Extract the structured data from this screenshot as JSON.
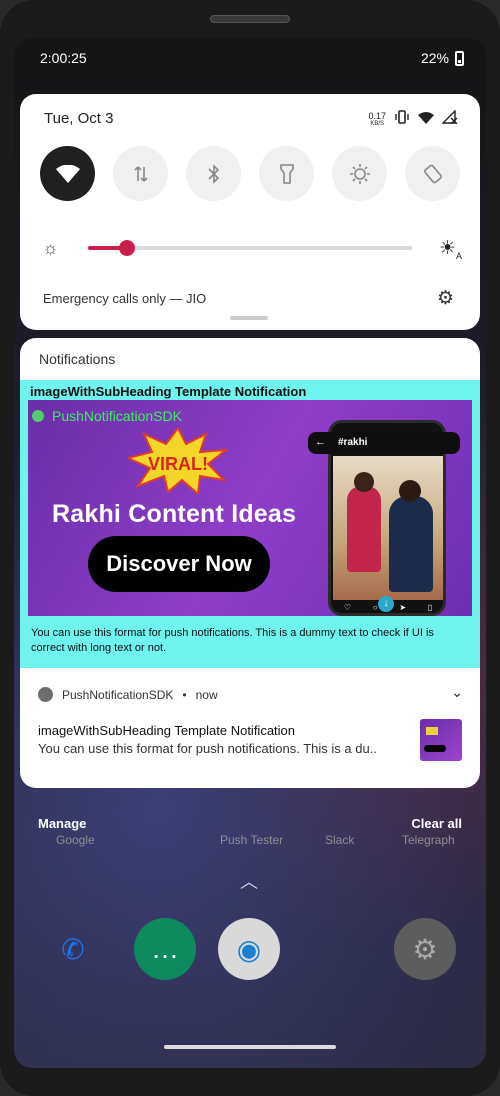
{
  "status_bar": {
    "time": "2:00:25",
    "battery": "22%"
  },
  "quick_settings": {
    "date": "Tue, Oct 3",
    "net_speed_value": "0.17",
    "net_speed_unit": "KB/S",
    "tiles": [
      {
        "name": "wifi",
        "active": true
      },
      {
        "name": "mobile-data",
        "active": false
      },
      {
        "name": "bluetooth",
        "active": false
      },
      {
        "name": "flashlight",
        "active": false
      },
      {
        "name": "auto-brightness",
        "active": false
      },
      {
        "name": "auto-rotate",
        "active": false
      }
    ],
    "brightness_level": 0.12,
    "auto_brightness_letter": "A",
    "footer_text": "Emergency calls only — JIO"
  },
  "notifications": {
    "header": "Notifications",
    "expanded": {
      "title": "imageWithSubHeading Template Notification",
      "app_name": "PushNotificationSDK",
      "banner": {
        "viral_label": "VIRAL!",
        "heading": "Rakhi Content Ideas",
        "button": "Discover Now",
        "phone_tag": "#rakhi"
      },
      "body": "You can use this format for push notifications. This is a dummy text to check if UI is correct with long text or not."
    },
    "collapsed": {
      "app_name": "PushNotificationSDK",
      "time": "now",
      "title": "imageWithSubHeading Template Notification",
      "text": "You can use this format for push notifications. This is a du.."
    }
  },
  "shade_actions": {
    "manage": "Manage",
    "clear_all": "Clear all"
  },
  "home_apps": [
    "Google",
    "Push Tester",
    "Slack",
    "Telegraph"
  ],
  "colors": {
    "accent": "#c71f4a",
    "teal": "#6ef3ef",
    "app_green": "#36f25a"
  }
}
